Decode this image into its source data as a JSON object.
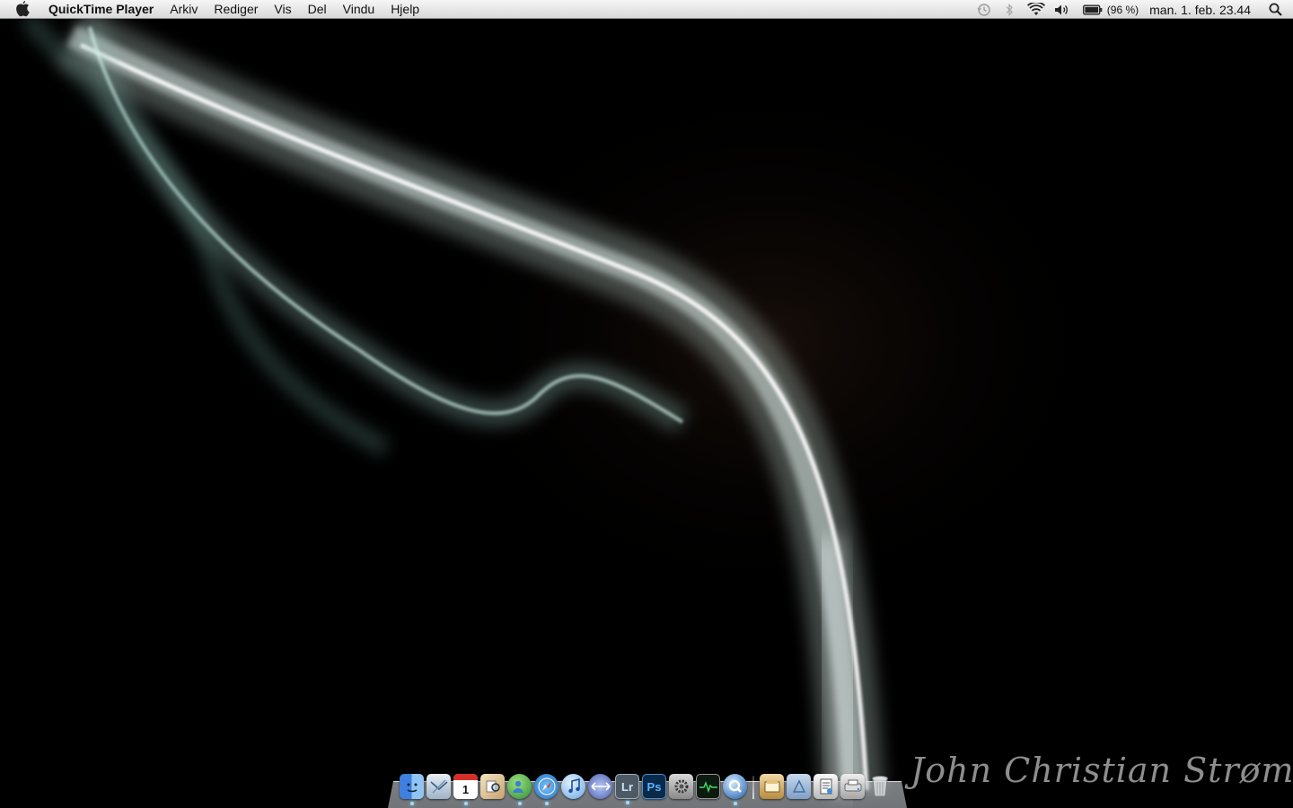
{
  "menubar": {
    "app_name": "QuickTime Player",
    "menus": [
      "Arkiv",
      "Rediger",
      "Vis",
      "Del",
      "Vindu",
      "Hjelp"
    ],
    "battery_percent": "(96 %)",
    "clock": "man. 1. feb.  23.44"
  },
  "dock": {
    "items": [
      {
        "name": "Finder",
        "icon": "finder-icon",
        "running": true
      },
      {
        "name": "Mail",
        "icon": "mail-icon",
        "running": false
      },
      {
        "name": "iCal",
        "icon": "calendar-icon",
        "label": "1",
        "running": true
      },
      {
        "name": "Preview",
        "icon": "preview-icon",
        "running": false
      },
      {
        "name": "iChat",
        "icon": "chat-icon",
        "running": true
      },
      {
        "name": "Safari",
        "icon": "safari-icon",
        "running": true
      },
      {
        "name": "iTunes",
        "icon": "itunes-icon",
        "running": false
      },
      {
        "name": "Transmit",
        "icon": "sync-icon",
        "running": false
      },
      {
        "name": "Lightroom",
        "icon": "lightroom-icon",
        "label": "Lr",
        "running": true
      },
      {
        "name": "Photoshop",
        "icon": "photoshop-icon",
        "label": "Ps",
        "running": false
      },
      {
        "name": "System Preferences",
        "icon": "gear-icon",
        "running": false
      },
      {
        "name": "Activity Monitor",
        "icon": "activity-monitor-icon",
        "running": false
      },
      {
        "name": "QuickTime Player",
        "icon": "quicktime-icon",
        "running": true
      }
    ],
    "stack_items": [
      {
        "name": "Documents stack",
        "icon": "stack-icon"
      },
      {
        "name": "Applications folder",
        "icon": "folder-icon"
      },
      {
        "name": "Downloads stack",
        "icon": "stack-icon"
      },
      {
        "name": "Printer",
        "icon": "printer-icon"
      },
      {
        "name": "Trash",
        "icon": "trash-icon"
      }
    ]
  },
  "desktop": {
    "signature": "John Christian Strømberg"
  }
}
